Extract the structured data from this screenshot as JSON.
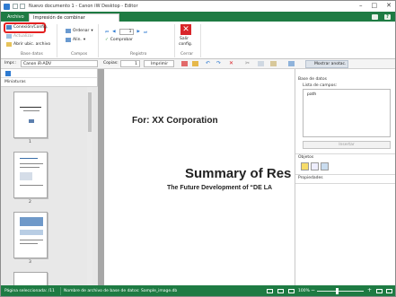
{
  "window": {
    "title": "Nuevo documento 1 - Canon iW Desktop - Editor",
    "help_icon": "?"
  },
  "tabs": {
    "file": "Archivo",
    "active": "Impresión de combinar correspondencia"
  },
  "ribbon": {
    "conexion": "Conexión/Config.",
    "actualizar": "Actualizar",
    "abrir_ubic": "Abrir ubic. archivo",
    "base_datos_group": "Base datos",
    "ordenar": "Ordenar",
    "alin": "Alin.",
    "campos_group": "Campos",
    "record_value": "1",
    "comprobar": "Comprobar",
    "registro_group": "Registro",
    "salir_line1": "Salir",
    "salir_line2": "config.",
    "cerrar_group": "Cerrar"
  },
  "toolbar": {
    "printer_label": "Impr.:",
    "printer_value": "Canon iR-ADV",
    "copies_label": "Copias:",
    "copies_value": "1",
    "print_label": "Imprimir",
    "show_annot": "Mostrar anotac."
  },
  "left_pane": {
    "label": "Miniaturas",
    "pages": [
      "1",
      "2",
      "3"
    ]
  },
  "document": {
    "line1": "For: XX Corporation",
    "line2": "Summary of Res",
    "line3": "The Future Development of “DE LA"
  },
  "right_pane": {
    "title": "Base de datos",
    "fields_label": "Lista de campos:",
    "field_item": "path",
    "insert_button": "Insertar",
    "objects_label": "Objetos",
    "properties_label": "Propiedades"
  },
  "status": {
    "pages": "Página seleccionada: /11",
    "db_file": "Nombre de archivo de base de datos: Sample_image.db",
    "zoom": "100%"
  },
  "colors": {
    "accent_green": "#1e7b43",
    "highlight_red": "#e32020",
    "exit_red": "#d9252a"
  }
}
